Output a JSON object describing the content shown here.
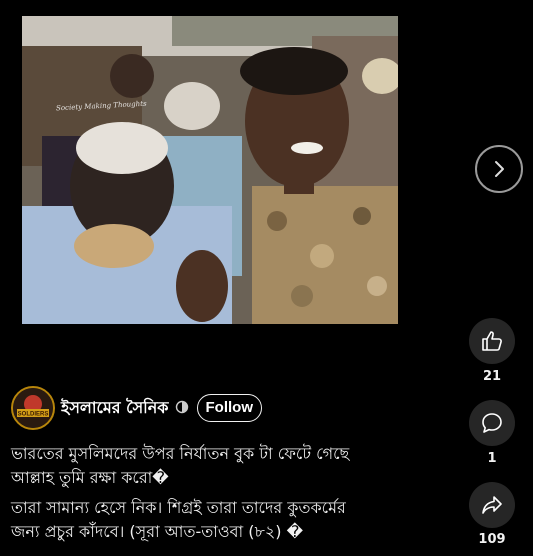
{
  "video": {
    "watermark": "Society Making Thoughts"
  },
  "actions": {
    "like_count": "21",
    "comment_count": "1",
    "share_count": "109"
  },
  "channel": {
    "name": "ইসলামের সৈনিক",
    "avatar_text": "SOLDIERS",
    "follow_label": "Follow"
  },
  "description": {
    "line1": "ভারতের মুসলিমদের উপর নির্যাতন বুক টা ফেটে গেছে",
    "line2": "আল্লাহ তুমি রক্ষা করো�",
    "line3": "তারা সামান্য হেসে নিক। শিগ্রই তারা তাদের কুতকর্মের",
    "line4": "জন্য প্রচুর কাঁদবে। (সূরা আত-তাওবা (৮২) �"
  },
  "colors": {
    "background": "#000000",
    "button_bg": "#262626",
    "avatar_ring": "#b8860b"
  }
}
